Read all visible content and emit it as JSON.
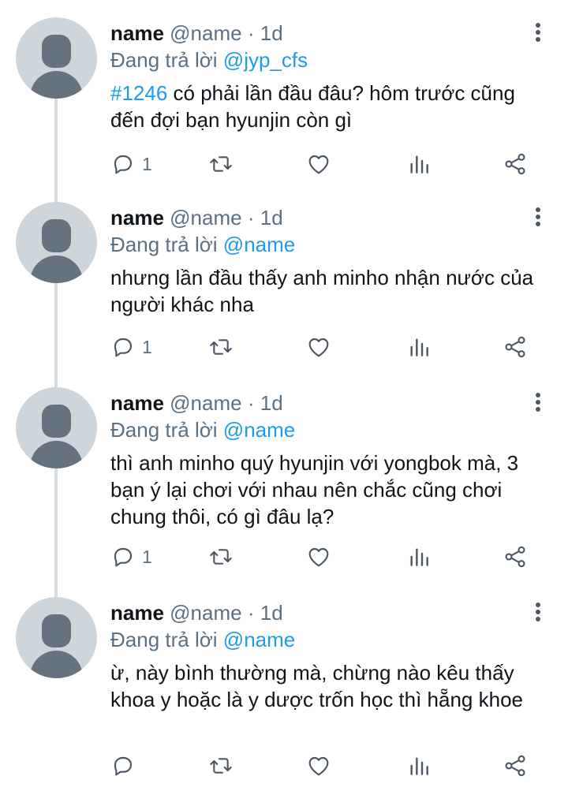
{
  "colors": {
    "link": "#1d9bf0",
    "secondary_text": "#5b7083",
    "avatar_bg": "#ced5db",
    "avatar_fg": "#66737f",
    "thread_line": "#d6dbdf"
  },
  "icons": {
    "reply": "reply-icon",
    "retweet": "retweet-icon",
    "like": "heart-icon",
    "stats": "analytics-icon",
    "share": "share-icon",
    "more": "more-vertical-icon"
  },
  "tweets": [
    {
      "name": "name",
      "handle": "@name",
      "separator": "·",
      "time": "1d",
      "replying_label": "Đang trả lời",
      "replying_to": "@jyp_cfs",
      "hashtag": "#1246",
      "text": " có phải lần đầu đâu? hôm trước cũng đến đợi bạn hyunjin còn gì",
      "reply_count": "1"
    },
    {
      "name": "name",
      "handle": "@name",
      "separator": "·",
      "time": "1d",
      "replying_label": "Đang trả lời",
      "replying_to": "@name",
      "text": "nhưng lần đầu thấy anh minho nhận nước của người khác nha",
      "reply_count": "1"
    },
    {
      "name": "name",
      "handle": "@name",
      "separator": "·",
      "time": "1d",
      "replying_label": "Đang trả lời",
      "replying_to": "@name",
      "text": "thì anh minho quý hyunjin với yongbok mà, 3 bạn ý lại chơi với nhau nên chắc cũng chơi chung thôi, có gì đâu lạ?",
      "reply_count": "1"
    },
    {
      "name": "name",
      "handle": "@name",
      "separator": "·",
      "time": "1d",
      "replying_label": "Đang trả lời",
      "replying_to": "@name",
      "text": "ừ, này bình thường mà, chừng nào kêu thấy khoa y hoặc là y dược trốn học thì hẵng khoe",
      "reply_count": ""
    }
  ]
}
